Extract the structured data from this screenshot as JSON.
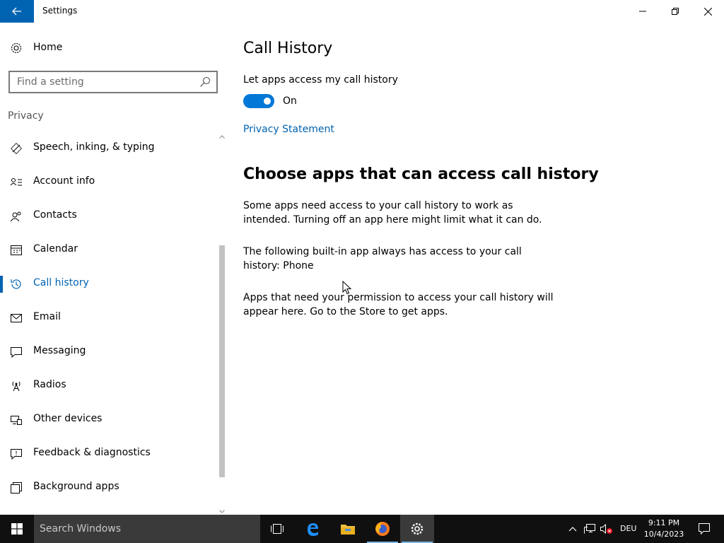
{
  "window": {
    "title": "Settings",
    "accent": "#0063b1"
  },
  "sidebar": {
    "home_label": "Home",
    "search_placeholder": "Find a setting",
    "section_label": "Privacy",
    "items": [
      {
        "label": "Speech, inking, & typing",
        "icon": "speech-icon"
      },
      {
        "label": "Account info",
        "icon": "account-info-icon"
      },
      {
        "label": "Contacts",
        "icon": "contacts-icon"
      },
      {
        "label": "Calendar",
        "icon": "calendar-icon"
      },
      {
        "label": "Call history",
        "icon": "history-icon",
        "active": true
      },
      {
        "label": "Email",
        "icon": "email-icon"
      },
      {
        "label": "Messaging",
        "icon": "messaging-icon"
      },
      {
        "label": "Radios",
        "icon": "radios-icon"
      },
      {
        "label": "Other devices",
        "icon": "other-devices-icon"
      },
      {
        "label": "Feedback & diagnostics",
        "icon": "feedback-icon"
      },
      {
        "label": "Background apps",
        "icon": "background-apps-icon"
      }
    ]
  },
  "main": {
    "title": "Call History",
    "toggle_label": "Let apps access my call history",
    "toggle_state": "On",
    "toggle_on": true,
    "privacy_link": "Privacy Statement",
    "section_title": "Choose apps that can access call history",
    "para1": "Some apps need access to your call history to work as intended. Turning off an app here might limit what it can do.",
    "para2": "The following built-in app always has access to your call history: Phone",
    "para3": "Apps that need your permission to access your call history will appear here. Go to the Store to get apps."
  },
  "taskbar": {
    "search_placeholder": "Search Windows",
    "language": "DEU",
    "time": "9:11 PM",
    "date": "10/4/2023"
  }
}
